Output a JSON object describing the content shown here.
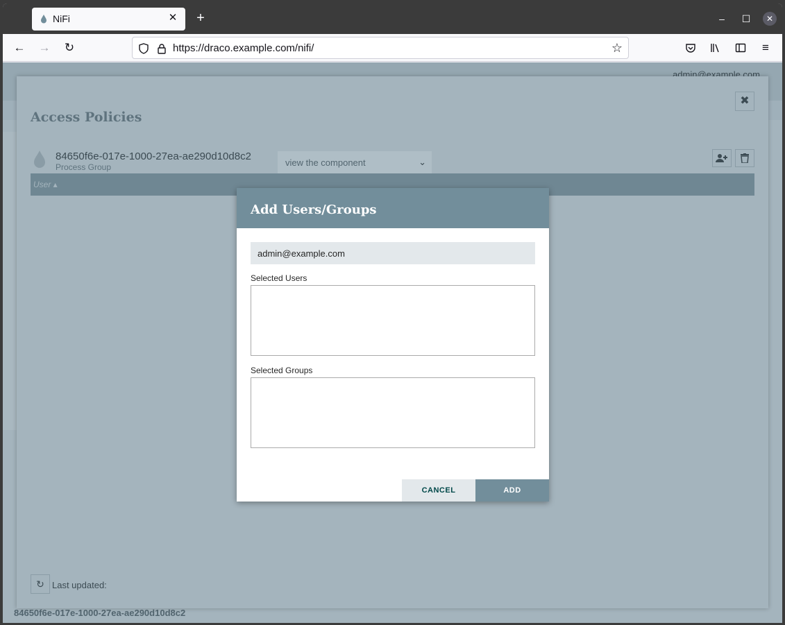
{
  "browser": {
    "tab_title": "NiFi",
    "url": "https://draco.example.com/nifi/"
  },
  "nifi": {
    "current_user": "admin@example.com",
    "footer_breadcrumb": "84650f6e-017e-1000-27ea-ae290d10d8c2"
  },
  "policies": {
    "title": "Access Policies",
    "component_id": "84650f6e-017e-1000-27ea-ae290d10d8c2",
    "component_type": "Process Group",
    "policy_selected": "view the component",
    "table_column": "User ▴",
    "last_updated_label": "Last updated:"
  },
  "modal": {
    "title": "Add Users/Groups",
    "user_input_value": "admin@example.com",
    "selected_users_label": "Selected Users",
    "selected_groups_label": "Selected Groups",
    "cancel_label": "CANCEL",
    "add_label": "ADD"
  }
}
